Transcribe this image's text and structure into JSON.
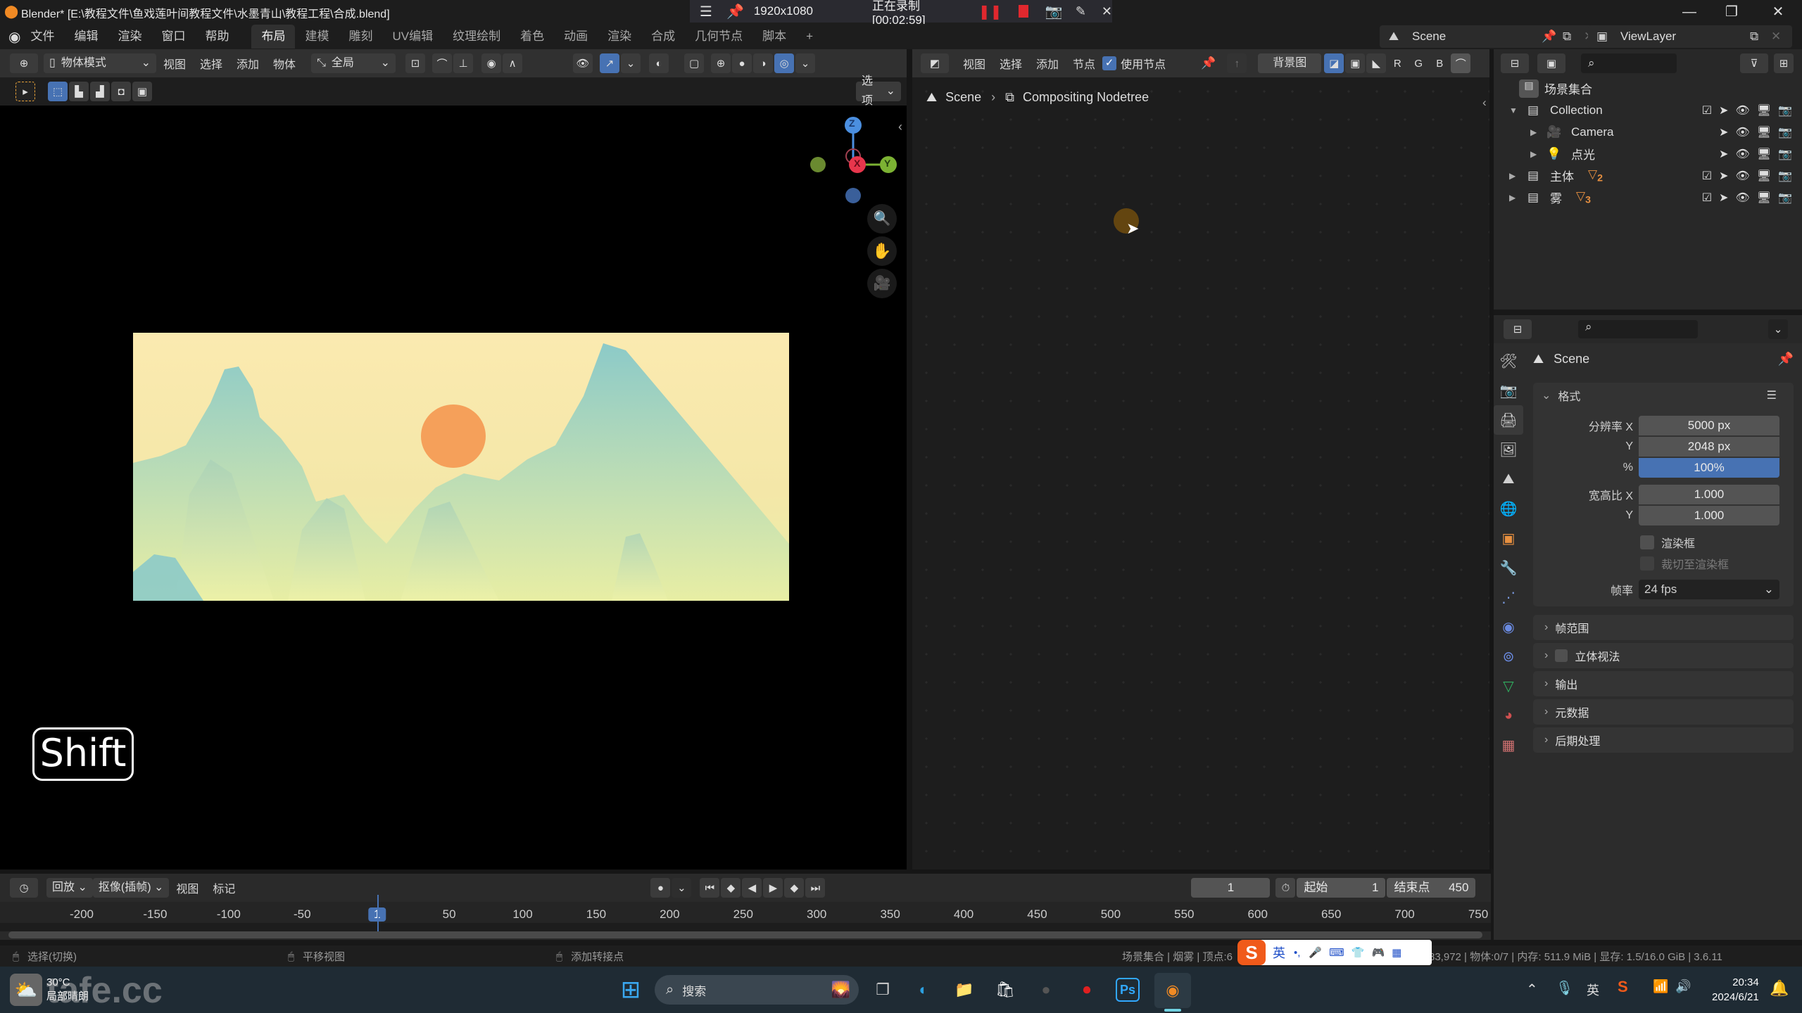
{
  "titlebar": {
    "title": "Blender* [E:\\教程文件\\鱼戏莲叶间教程文件\\水墨青山\\教程工程\\合成.blend]",
    "recorder": {
      "resolution": "1920x1080",
      "status": "正在录制 [00:02:59]"
    },
    "window_controls": [
      "—",
      "❐",
      "✕"
    ]
  },
  "menubar": {
    "menus": [
      "文件",
      "编辑",
      "渲染",
      "窗口",
      "帮助"
    ],
    "workspaces": [
      "布局",
      "建模",
      "雕刻",
      "UV编辑",
      "纹理绘制",
      "着色",
      "动画",
      "渲染",
      "合成",
      "几何节点",
      "脚本"
    ],
    "active_workspace": "布局",
    "add_workspace": "+",
    "scene": "Scene",
    "view_layer": "ViewLayer"
  },
  "viewport": {
    "mode": "物体模式",
    "menus": [
      "视图",
      "选择",
      "添加",
      "物体"
    ],
    "transform_orientation": "全局",
    "options_label": "选项",
    "gizmo_axes": {
      "z": "Z",
      "y": "Y",
      "x": "X"
    },
    "key_overlay": "Shift",
    "render_colors": {
      "sky": "#fbeab0",
      "mountain": "#8ccac8",
      "sun": "#f5a05a"
    }
  },
  "node_editor": {
    "menus": [
      "视图",
      "选择",
      "添加",
      "节点"
    ],
    "use_nodes_label": "使用节点",
    "use_nodes_checked": true,
    "backdrop_label": "背景图",
    "channels": [
      "R",
      "G",
      "B"
    ],
    "breadcrumb": [
      "Scene",
      "Compositing Nodetree"
    ]
  },
  "outliner": {
    "root": "场景集合",
    "items": [
      {
        "name": "Collection",
        "level": 0,
        "expanded": true,
        "checkbox": true
      },
      {
        "name": "Camera",
        "level": 1,
        "expanded": false,
        "checkbox": false
      },
      {
        "name": "点光",
        "level": 1,
        "expanded": false,
        "checkbox": false
      },
      {
        "name": "主体",
        "level": 0,
        "expanded": false,
        "checkbox": true,
        "badge": "2"
      },
      {
        "name": "雾",
        "level": 0,
        "expanded": false,
        "checkbox": true,
        "badge": "3"
      }
    ]
  },
  "properties": {
    "context": "Scene",
    "format_panel": {
      "title": "格式",
      "res_x_label": "分辨率 X",
      "res_x": "5000 px",
      "res_y_label": "Y",
      "res_y": "2048 px",
      "percent_label": "%",
      "percent": "100%",
      "aspect_x_label": "宽高比 X",
      "aspect_x": "1.000",
      "aspect_y_label": "Y",
      "aspect_y": "1.000",
      "render_region": "渲染框",
      "crop_region": "裁切至渲染框",
      "fps_label": "帧率",
      "fps": "24 fps"
    },
    "collapsed_panels": [
      "帧范围",
      "立体视法",
      "输出",
      "元数据",
      "后期处理"
    ]
  },
  "timeline": {
    "menus": [
      "回放",
      "抠像(插帧)",
      "视图",
      "标记"
    ],
    "current_frame": "1",
    "start_label": "起始",
    "start": "1",
    "end_label": "结束点",
    "end": "450",
    "ticks": [
      "-200",
      "-150",
      "-100",
      "-50",
      "1",
      "50",
      "100",
      "150",
      "200",
      "250",
      "300",
      "350",
      "400",
      "450",
      "500",
      "550",
      "600",
      "650",
      "700",
      "750"
    ],
    "playhead": "1"
  },
  "statusbar": {
    "hints": [
      "选择(切换)",
      "平移视图",
      "添加转接点"
    ],
    "stats_left": "场景集合 | 烟雾 | 顶点:6",
    "stats_right": "83,972 | 物体:0/7 | 内存: 511.9 MiB | 显存: 1.5/16.0 GiB | 3.6.11",
    "ime": [
      "英",
      "•,"
    ]
  },
  "taskbar": {
    "weather_temp": "30°C",
    "weather_desc": "局部晴朗",
    "watermark": "tafe.cc",
    "search": "搜索",
    "tray_lang": "英",
    "time": "20:34",
    "date": "2024/6/21"
  }
}
